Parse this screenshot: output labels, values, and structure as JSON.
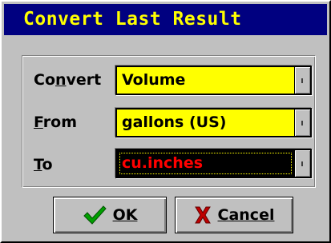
{
  "title": "Convert Last Result",
  "rows": [
    {
      "label_hot": "n",
      "label": "Convert",
      "value": "Volume"
    },
    {
      "label": "From",
      "value": "gallons (US)"
    },
    {
      "label": "To",
      "value": "cu.inches"
    }
  ],
  "buttons": {
    "ok": "OK",
    "cancel": "Cancel"
  },
  "colors": {
    "title_bg": "#000080",
    "title_fg": "#ffff00",
    "field_bg": "#ffff00",
    "field_selected_bg": "#000000",
    "field_selected_fg": "#ff0000",
    "ok_icon": "#00a000",
    "cancel_icon": "#c00000"
  },
  "icons": {
    "ok": "checkmark-icon",
    "cancel": "x-icon",
    "dropdown": "dropdown-arrow-icon"
  }
}
